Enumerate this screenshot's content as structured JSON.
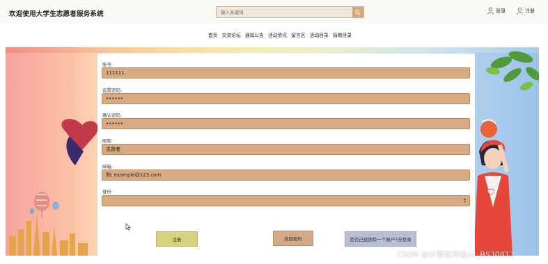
{
  "header": {
    "site_title": "欢迎使用大学生志愿者服务系统",
    "search_placeholder": "输入关键词",
    "login_label": "登录",
    "register_label": "注册"
  },
  "nav": {
    "items": [
      {
        "label": "首页"
      },
      {
        "label": "交流论坛"
      },
      {
        "label": "通知公告"
      },
      {
        "label": "活动资讯"
      },
      {
        "label": "留言区"
      },
      {
        "label": "活动目录"
      },
      {
        "label": "捐赠目录"
      }
    ]
  },
  "form": {
    "account_label": "账号:",
    "account_value": "111111",
    "password_label": "设置密码:",
    "password_value": "••••••",
    "confirm_label": "确认密码:",
    "confirm_value": "••••••",
    "nickname_label": "昵称:",
    "nickname_value": "志愿者",
    "email_label": "邮箱:",
    "email_value": "例: example@123.com",
    "role_label": "身份:",
    "role_value": ""
  },
  "buttons": {
    "register": "注册",
    "forgot_password": "找回密码",
    "has_account_login": "是否已经拥有一个账户?去登录"
  },
  "watermark": "CSDN @计算机毕设xx_BS30813",
  "colors": {
    "input_fill": "#d9aa82",
    "register_button": "#d6d27d",
    "forgot_button": "#d4a987",
    "login_button": "#b7bfd4",
    "search_button": "#d3a883"
  }
}
